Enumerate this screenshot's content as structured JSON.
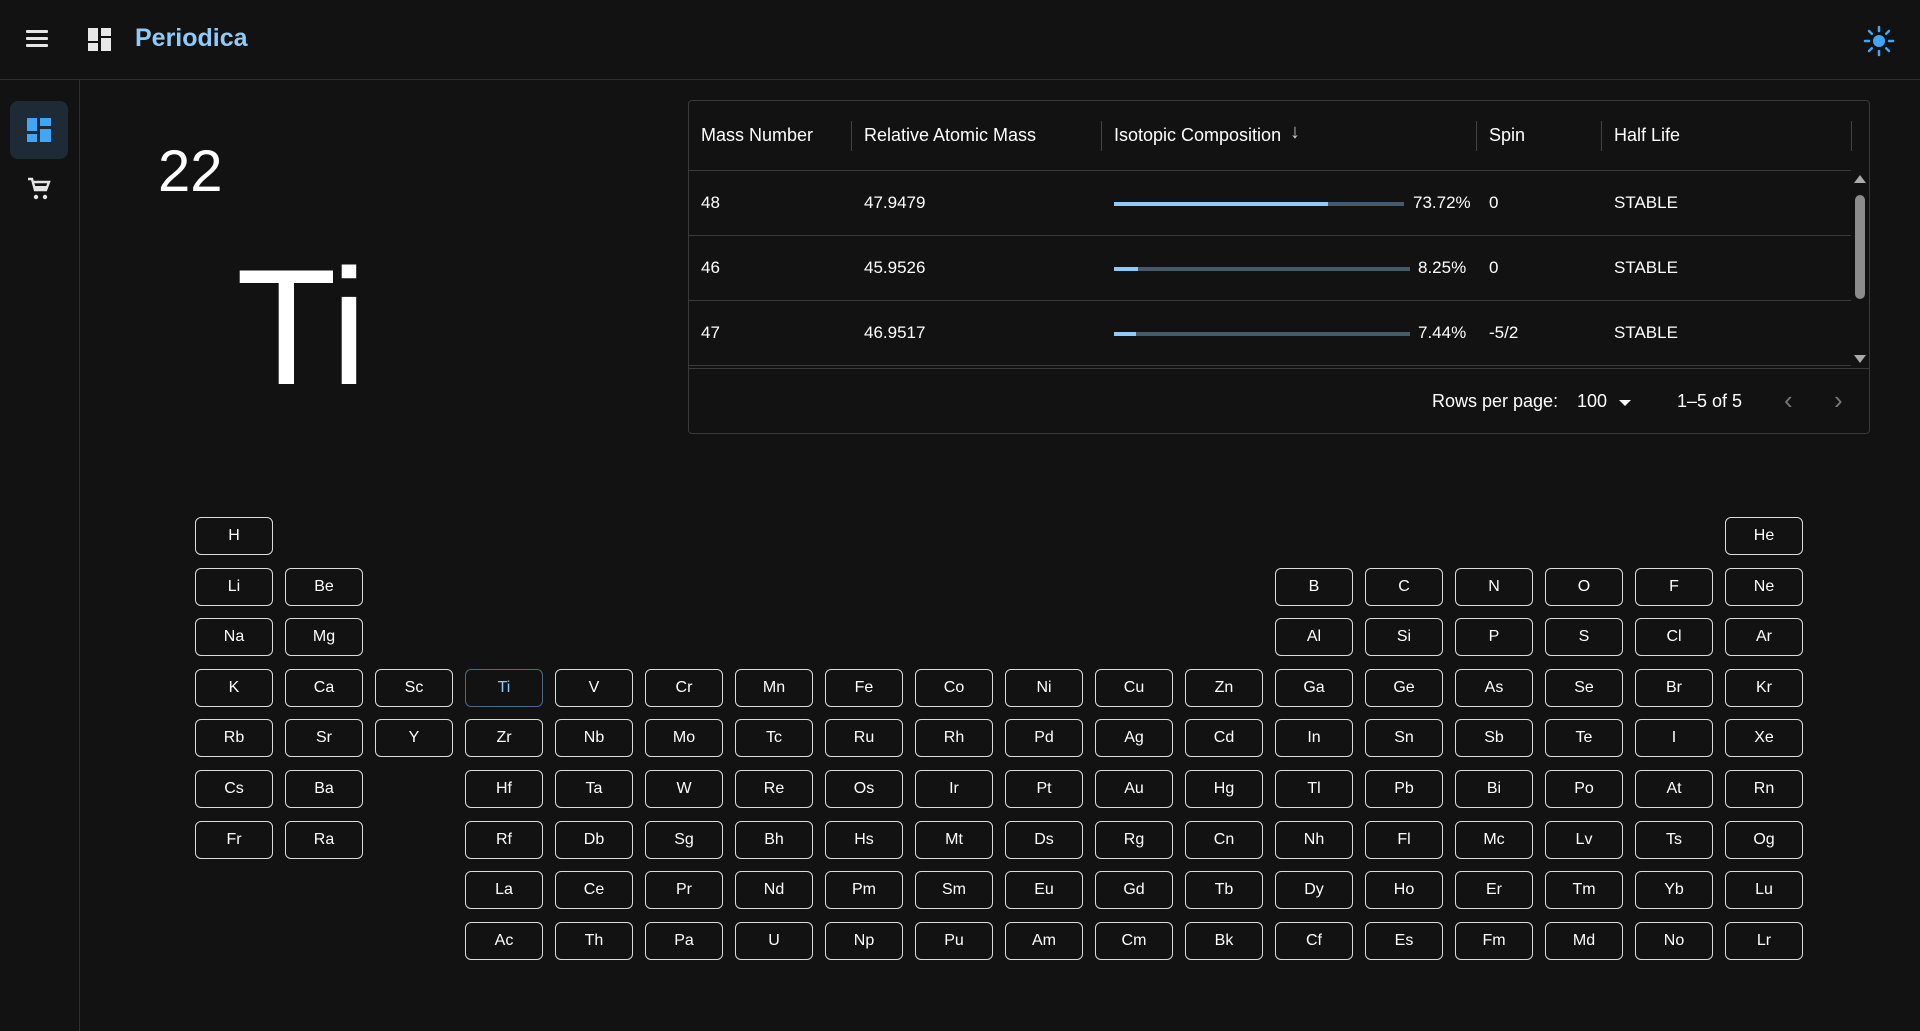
{
  "app": {
    "title": "Periodica"
  },
  "element": {
    "number": "22",
    "symbol": "Ti"
  },
  "isotopes": {
    "columns": [
      "Mass Number",
      "Relative Atomic Mass",
      "Isotopic Composition",
      "Spin",
      "Half Life"
    ],
    "sorted_column": "Isotopic Composition",
    "sort_direction": "descending",
    "rows": [
      {
        "mass_number": "48",
        "relative_mass": "47.9479",
        "composition": "73.72%",
        "composition_value": 73.72,
        "spin": "0",
        "half_life": "STABLE"
      },
      {
        "mass_number": "46",
        "relative_mass": "45.9526",
        "composition": "8.25%",
        "composition_value": 8.25,
        "spin": "0",
        "half_life": "STABLE"
      },
      {
        "mass_number": "47",
        "relative_mass": "46.9517",
        "composition": "7.44%",
        "composition_value": 7.44,
        "spin": "-5/2",
        "half_life": "STABLE"
      }
    ],
    "footer": {
      "rows_per_page_label": "Rows per page:",
      "rows_per_page": "100",
      "range": "1–5 of 5"
    }
  },
  "periodic_table": {
    "selected": "Ti",
    "rows": [
      [
        "H",
        "",
        "",
        "",
        "",
        "",
        "",
        "",
        "",
        "",
        "",
        "",
        "",
        "",
        "",
        "",
        "",
        "He"
      ],
      [
        "Li",
        "Be",
        "",
        "",
        "",
        "",
        "",
        "",
        "",
        "",
        "",
        "",
        "B",
        "C",
        "N",
        "O",
        "F",
        "Ne"
      ],
      [
        "Na",
        "Mg",
        "",
        "",
        "",
        "",
        "",
        "",
        "",
        "",
        "",
        "",
        "Al",
        "Si",
        "P",
        "S",
        "Cl",
        "Ar"
      ],
      [
        "K",
        "Ca",
        "Sc",
        "Ti",
        "V",
        "Cr",
        "Mn",
        "Fe",
        "Co",
        "Ni",
        "Cu",
        "Zn",
        "Ga",
        "Ge",
        "As",
        "Se",
        "Br",
        "Kr"
      ],
      [
        "Rb",
        "Sr",
        "Y",
        "Zr",
        "Nb",
        "Mo",
        "Tc",
        "Ru",
        "Rh",
        "Pd",
        "Ag",
        "Cd",
        "In",
        "Sn",
        "Sb",
        "Te",
        "I",
        "Xe"
      ],
      [
        "Cs",
        "Ba",
        "",
        "Hf",
        "Ta",
        "W",
        "Re",
        "Os",
        "Ir",
        "Pt",
        "Au",
        "Hg",
        "Tl",
        "Pb",
        "Bi",
        "Po",
        "At",
        "Rn"
      ],
      [
        "Fr",
        "Ra",
        "",
        "Rf",
        "Db",
        "Sg",
        "Bh",
        "Hs",
        "Mt",
        "Ds",
        "Rg",
        "Cn",
        "Nh",
        "Fl",
        "Mc",
        "Lv",
        "Ts",
        "Og"
      ],
      [
        "",
        "",
        "",
        "La",
        "Ce",
        "Pr",
        "Nd",
        "Pm",
        "Sm",
        "Eu",
        "Gd",
        "Tb",
        "Dy",
        "Ho",
        "Er",
        "Tm",
        "Yb",
        "Lu"
      ],
      [
        "",
        "",
        "",
        "Ac",
        "Th",
        "Pa",
        "U",
        "Np",
        "Pu",
        "Am",
        "Cm",
        "Bk",
        "Cf",
        "Es",
        "Fm",
        "Md",
        "No",
        "Lr"
      ]
    ]
  },
  "colors": {
    "accent": "#90caf9",
    "background": "#121212"
  },
  "icons": {
    "menu": "menu-icon",
    "logo": "dashboard-icon",
    "theme": "sun-icon",
    "nav_dashboard": "dashboard-icon",
    "nav_cart": "cart-icon"
  }
}
